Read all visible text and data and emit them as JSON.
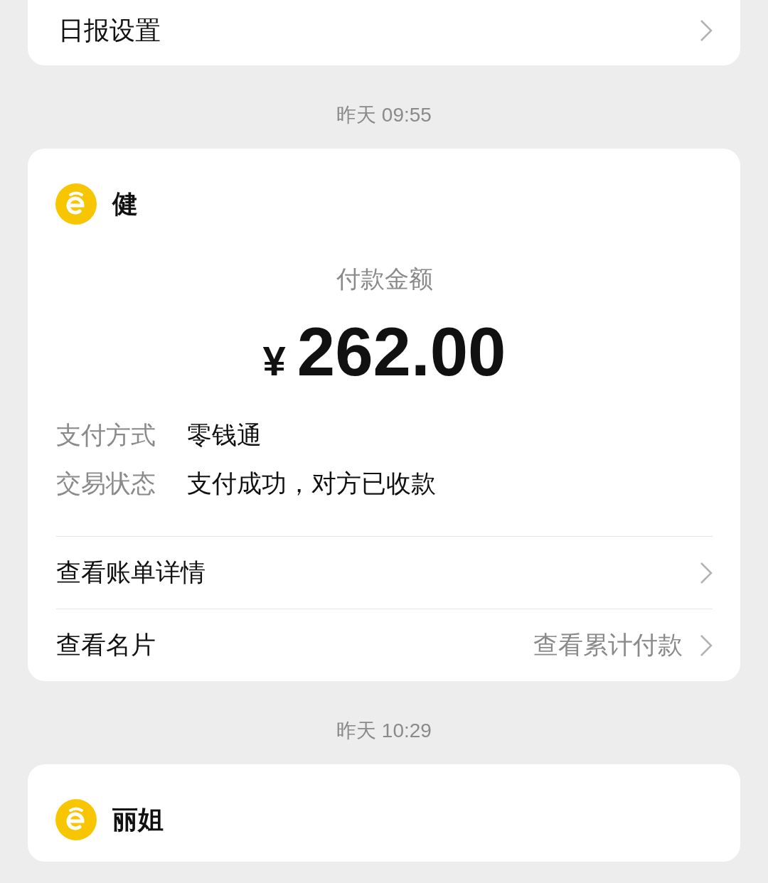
{
  "top_card": {
    "label": "日报设置"
  },
  "messages": [
    {
      "time": "昨天 09:55",
      "payer": "健",
      "amount_label": "付款金额",
      "currency": "¥",
      "amount": "262.00",
      "details": [
        {
          "label": "支付方式",
          "value": "零钱通"
        },
        {
          "label": "交易状态",
          "value": "支付成功，对方已收款"
        }
      ],
      "links": [
        {
          "label": "查看账单详情"
        },
        {
          "label": "查看名片",
          "extra": "查看累计付款"
        }
      ]
    },
    {
      "time": "昨天 10:29",
      "payer": "丽姐"
    }
  ]
}
